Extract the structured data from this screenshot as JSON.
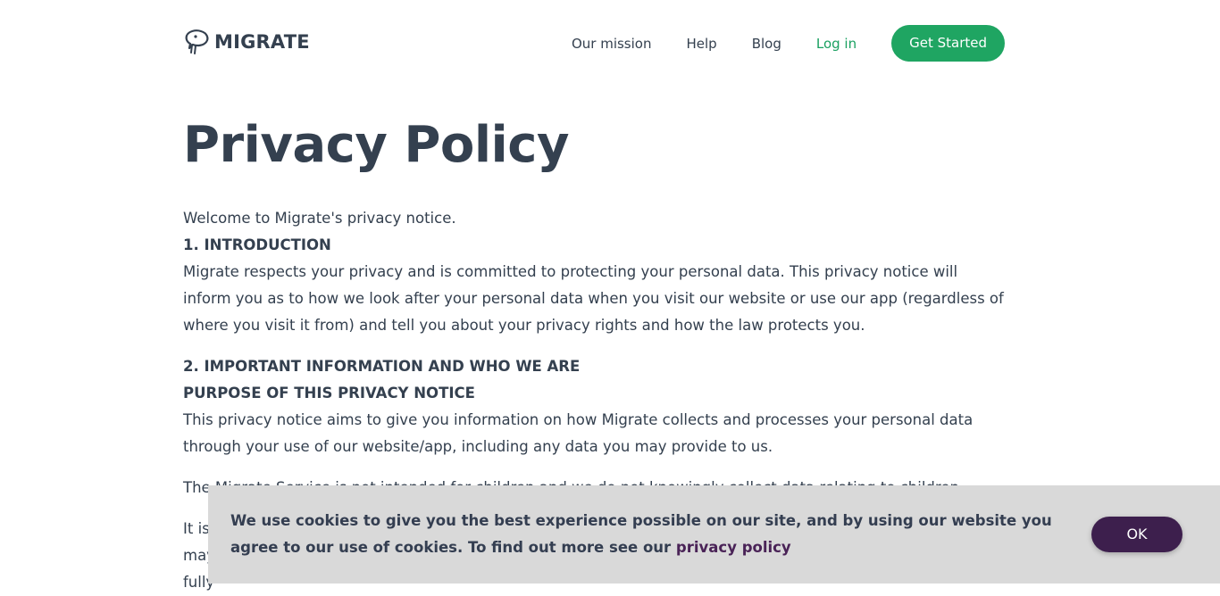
{
  "header": {
    "logo_text": "MIGRATE",
    "logo_icon": "migrate-bird-icon",
    "nav": {
      "our_mission": "Our mission",
      "help": "Help",
      "blog": "Blog",
      "log_in": "Log in"
    },
    "cta": "Get Started"
  },
  "page": {
    "title": "Privacy Policy",
    "welcome": "Welcome to Migrate's privacy notice.",
    "section1_heading": "1. INTRODUCTION",
    "section1_body": "Migrate respects your privacy and is committed to protecting your personal data. This privacy notice will inform you as to how we look after your personal data when you visit our website or use our app (regardless of where you visit it from) and tell you about your privacy rights and how the law protects you.",
    "section2_heading": "2. IMPORTANT INFORMATION AND WHO WE ARE",
    "purpose_heading": "PURPOSE OF THIS PRIVACY NOTICE",
    "purpose_body": "This privacy notice aims to give you information on how Migrate collects and processes your personal data through your use of our website/app, including any data you may provide to us.",
    "partial_line_1": "The Migrate Service is not intended for children and we do not knowingly collect data relating to children.",
    "partial_line_2": "It is",
    "partial_line_3": "may",
    "partial_line_4": "fully"
  },
  "cookie_banner": {
    "text": "We use cookies to give you the best experience possible on our site, and by using our website you agree to our use of cookies. To find out more see our ",
    "link": "privacy policy",
    "ok": "OK"
  },
  "colors": {
    "brand_green": "#1fa562",
    "text": "#34404f",
    "cookie_bg": "#d9d9d9",
    "ok_button": "#3d1f4d"
  }
}
